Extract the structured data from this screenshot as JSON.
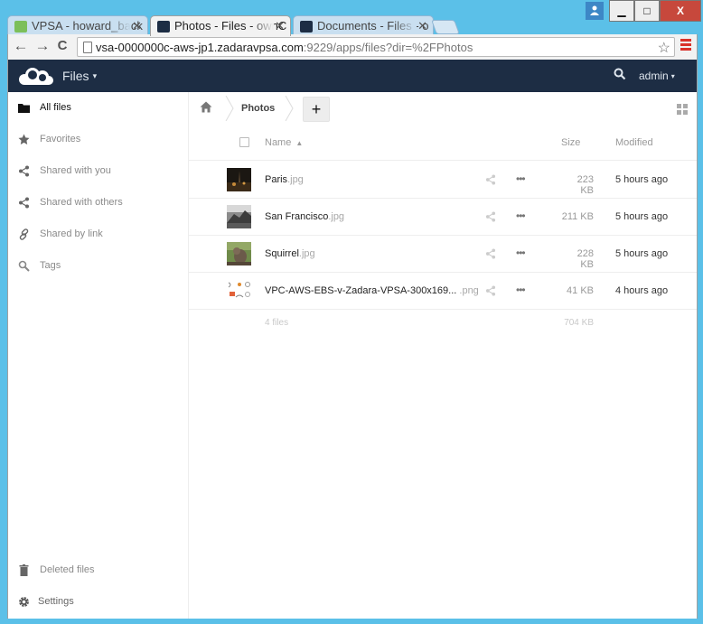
{
  "browser": {
    "tabs": [
      {
        "title": "VPSA - howard_back",
        "favicon_color": "#7cbf5a"
      },
      {
        "title": "Photos - Files - ownC",
        "favicon_color": "#1d2d44"
      },
      {
        "title": "Documents - Files - o",
        "favicon_color": "#1d2d44"
      }
    ],
    "url_host": "vsa-0000000c-aws-jp1.zadaravpsa.com",
    "url_rest": ":9229/apps/files?dir=%2FPhotos",
    "window_buttons": {
      "minimize": "▁",
      "maximize": "□",
      "close": "X"
    },
    "nav": {
      "back": "←",
      "forward": "→",
      "reload": "C"
    },
    "icons": [
      "back-arrow-icon",
      "forward-arrow-icon",
      "reload-icon",
      "page-icon",
      "bookmark-star-icon",
      "menu-icon"
    ]
  },
  "header": {
    "app_name": "Files",
    "caret": "▾",
    "user": "admin",
    "colors": {
      "bar": "#1d2d44",
      "text": "#dfe6ee"
    }
  },
  "sidebar": {
    "items": [
      {
        "label": "All files",
        "icon": "folder-icon",
        "active": true
      },
      {
        "label": "Favorites",
        "icon": "star-icon",
        "active": false
      },
      {
        "label": "Shared with you",
        "icon": "share-icon",
        "active": false
      },
      {
        "label": "Shared with others",
        "icon": "share-icon",
        "active": false
      },
      {
        "label": "Shared by link",
        "icon": "link-icon",
        "active": false
      },
      {
        "label": "Tags",
        "icon": "tag-search-icon",
        "active": false
      }
    ],
    "bottom": [
      {
        "label": "Deleted files",
        "icon": "trash-icon"
      },
      {
        "label": "Settings",
        "icon": "gear-icon"
      }
    ]
  },
  "breadcrumb": {
    "current": "Photos",
    "add_label": "+"
  },
  "table": {
    "headers": {
      "name": "Name",
      "sort": "▲",
      "size": "Size",
      "modified": "Modified"
    },
    "more_label": "•••",
    "rows": [
      {
        "name": "Paris",
        "ext": ".jpg",
        "size": "223 KB",
        "modified": "5 hours ago"
      },
      {
        "name": "San Francisco",
        "ext": ".jpg",
        "size": "211 KB",
        "modified": "5 hours ago"
      },
      {
        "name": "Squirrel",
        "ext": ".jpg",
        "size": "228 KB",
        "modified": "5 hours ago"
      },
      {
        "name": "VPC-AWS-EBS-v-Zadara-VPSA-300x169... ",
        "ext": ".png",
        "size": "41 KB",
        "modified": "4 hours ago"
      }
    ],
    "summary": {
      "count": "4 files",
      "total": "704 KB"
    }
  }
}
